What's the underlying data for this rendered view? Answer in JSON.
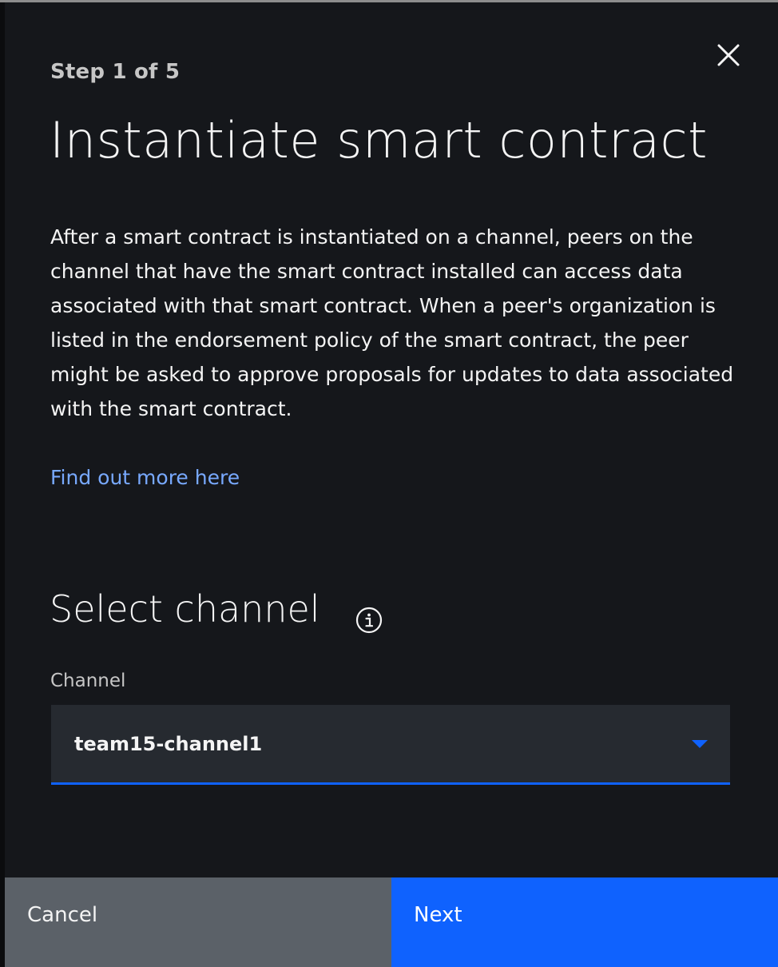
{
  "modal": {
    "step_label": "Step 1 of 5",
    "title": "Instantiate smart contract",
    "description": "After a smart contract is instantiated on a channel, peers on the channel that have the smart contract installed can access data associated with that smart contract. When a peer's organization is listed in the endorsement policy of the smart contract, the peer might be asked to approve proposals for updates to data associated with the smart contract.",
    "link_text": "Find out more here",
    "close_icon": "close-icon"
  },
  "channel_section": {
    "title": "Select channel",
    "info_icon": "info-icon",
    "field_label": "Channel",
    "selected_value": "team15-channel1"
  },
  "footer": {
    "cancel_label": "Cancel",
    "next_label": "Next"
  },
  "colors": {
    "background": "#15171b",
    "accent": "#0f62fe",
    "link": "#78a9ff",
    "secondary_button": "#5b6168",
    "field_background": "#262a30"
  }
}
